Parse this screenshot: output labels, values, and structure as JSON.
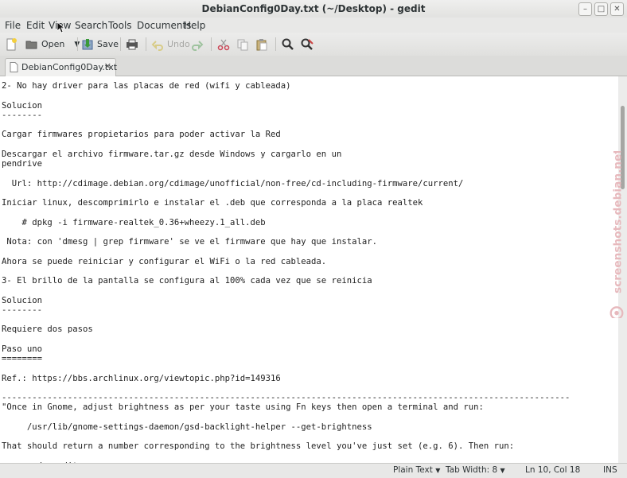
{
  "window": {
    "title": "DebianConfig0Day.txt (~/Desktop) - gedit"
  },
  "menu": {
    "file": "File",
    "edit": "Edit",
    "view": "View",
    "search": "Search",
    "tools": "Tools",
    "documents": "Documents",
    "help": "Help"
  },
  "toolbar": {
    "open": "Open",
    "save": "Save",
    "undo": "Undo"
  },
  "tab": {
    "label": "DebianConfig0Day.txt"
  },
  "editor_lines": [
    "2- No hay driver para las placas de red (wifi y cableada)",
    "",
    "Solucion",
    "--------",
    "",
    "Cargar firmwares propietarios para poder activar la Red",
    "",
    "Descargar el archivo firmware.tar.gz desde Windows y cargarlo en un",
    "pendrive",
    "",
    "  Url: http://cdimage.debian.org/cdimage/unofficial/non-free/cd-including-firmware/current/",
    "",
    "Iniciar linux, descomprimirlo e instalar el .deb que corresponda a la placa realtek",
    "",
    "    # dpkg -i firmware-realtek_0.36+wheezy.1_all.deb",
    "",
    " Nota: con 'dmesg | grep firmware' se ve el firmware que hay que instalar.",
    "",
    "Ahora se puede reiniciar y configurar el WiFi o la red cableada.",
    "",
    "3- El brillo de la pantalla se configura al 100% cada vez que se reinicia",
    "",
    "Solucion",
    "--------",
    "",
    "Requiere dos pasos",
    "",
    "Paso uno",
    "========",
    "",
    "Ref.: https://bbs.archlinux.org/viewtopic.php?id=149316",
    "",
    "----------------------------------------------------------------------------------------------------------------",
    "\"Once in Gnome, adjust brightness as per your taste using Fn keys then open a terminal and run:",
    "",
    "     /usr/lib/gnome-settings-daemon/gsd-backlight-helper --get-brightness",
    "",
    "That should return a number corresponding to the brightness level you've just set (e.g. 6). Then run:",
    "",
    "     sudo gedit ..."
  ],
  "watermark": {
    "text": "screenshots.debian.net"
  },
  "status": {
    "language": "Plain Text",
    "tab_width": "Tab Width:  8",
    "position": "Ln 10, Col 18",
    "mode": "INS"
  }
}
